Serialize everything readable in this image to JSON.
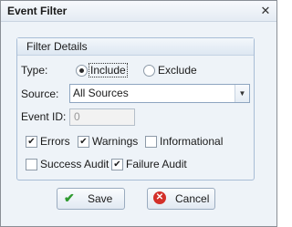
{
  "window": {
    "title": "Event Filter",
    "close_glyph": "✕"
  },
  "group": {
    "header": "Filter Details"
  },
  "type": {
    "label": "Type:",
    "options": [
      "Include",
      "Exclude"
    ],
    "selected": "Include"
  },
  "source": {
    "label": "Source:",
    "value": "All Sources"
  },
  "event_id": {
    "label": "Event ID:",
    "value": "0"
  },
  "checkboxes": [
    {
      "label": "Errors",
      "checked": true
    },
    {
      "label": "Warnings",
      "checked": true
    },
    {
      "label": "Informational",
      "checked": false
    },
    {
      "label": "Success Audit",
      "checked": false
    },
    {
      "label": "Failure Audit",
      "checked": true
    }
  ],
  "buttons": {
    "save": "Save",
    "cancel": "Cancel"
  },
  "icons": {
    "save": "checkmark-icon",
    "cancel": "cancel-icon",
    "dropdown": "chevron-down-icon"
  }
}
